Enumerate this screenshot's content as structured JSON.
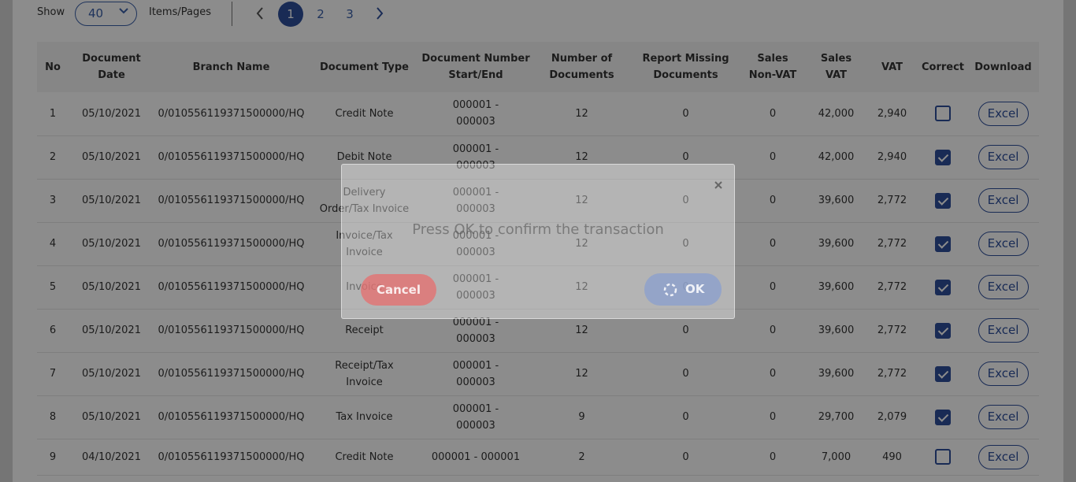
{
  "toolbar": {
    "show_label": "Show",
    "page_size": "40",
    "items_label": "Items/Pages",
    "pages": [
      "1",
      "2",
      "3"
    ],
    "active_page": "1"
  },
  "table": {
    "headers": [
      [
        "No"
      ],
      [
        "Document",
        "Date"
      ],
      [
        "Branch Name"
      ],
      [
        "Document Type"
      ],
      [
        "Document Number",
        "Start/End"
      ],
      [
        "Number of",
        "Documents"
      ],
      [
        "Report Missing",
        "Documents"
      ],
      [
        "Sales",
        "Non-VAT"
      ],
      [
        "Sales",
        "VAT"
      ],
      [
        "VAT"
      ],
      [
        "Correct"
      ],
      [
        "Download"
      ]
    ],
    "rows": [
      {
        "no": "1",
        "date": "05/10/2021",
        "branch": "0/010556119371500000/HQ",
        "type": [
          "Credit Note"
        ],
        "docnum": [
          "000001 -",
          "000003"
        ],
        "count": "12",
        "missing": "0",
        "nonvat": "0",
        "vat_sales": "42,000",
        "vat": "2,940",
        "correct": false,
        "download": "Excel"
      },
      {
        "no": "2",
        "date": "05/10/2021",
        "branch": "0/010556119371500000/HQ",
        "type": [
          "Debit Note"
        ],
        "docnum": [
          "000001 -",
          "000003"
        ],
        "count": "12",
        "missing": "0",
        "nonvat": "0",
        "vat_sales": "42,000",
        "vat": "2,940",
        "correct": true,
        "download": "Excel"
      },
      {
        "no": "3",
        "date": "05/10/2021",
        "branch": "0/010556119371500000/HQ",
        "type": [
          "Delivery",
          "Order/Tax Invoice"
        ],
        "docnum": [
          "000001 -",
          "000003"
        ],
        "count": "12",
        "missing": "0",
        "nonvat": "0",
        "vat_sales": "39,600",
        "vat": "2,772",
        "correct": true,
        "download": "Excel"
      },
      {
        "no": "4",
        "date": "05/10/2021",
        "branch": "0/010556119371500000/HQ",
        "type": [
          "Invoice/Tax",
          "Invoice"
        ],
        "docnum": [
          "000001 -",
          "000003"
        ],
        "count": "12",
        "missing": "0",
        "nonvat": "0",
        "vat_sales": "39,600",
        "vat": "2,772",
        "correct": true,
        "download": "Excel"
      },
      {
        "no": "5",
        "date": "05/10/2021",
        "branch": "0/010556119371500000/HQ",
        "type": [
          "Invoice"
        ],
        "docnum": [
          "000001 -",
          "000003"
        ],
        "count": "12",
        "missing": "0",
        "nonvat": "0",
        "vat_sales": "39,600",
        "vat": "2,772",
        "correct": true,
        "download": "Excel"
      },
      {
        "no": "6",
        "date": "05/10/2021",
        "branch": "0/010556119371500000/HQ",
        "type": [
          "Receipt"
        ],
        "docnum": [
          "000001 -",
          "000003"
        ],
        "count": "12",
        "missing": "0",
        "nonvat": "0",
        "vat_sales": "39,600",
        "vat": "2,772",
        "correct": true,
        "download": "Excel"
      },
      {
        "no": "7",
        "date": "05/10/2021",
        "branch": "0/010556119371500000/HQ",
        "type": [
          "Receipt/Tax",
          "Invoice"
        ],
        "docnum": [
          "000001 -",
          "000003"
        ],
        "count": "12",
        "missing": "0",
        "nonvat": "0",
        "vat_sales": "39,600",
        "vat": "2,772",
        "correct": true,
        "download": "Excel"
      },
      {
        "no": "8",
        "date": "05/10/2021",
        "branch": "0/010556119371500000/HQ",
        "type": [
          "Tax Invoice"
        ],
        "docnum": [
          "000001 -",
          "000003"
        ],
        "count": "9",
        "missing": "0",
        "nonvat": "0",
        "vat_sales": "29,700",
        "vat": "2,079",
        "correct": true,
        "download": "Excel"
      },
      {
        "no": "9",
        "date": "04/10/2021",
        "branch": "0/010556119371500000/HQ",
        "type": [
          "Credit Note"
        ],
        "docnum": [
          "000001 - 000001"
        ],
        "count": "2",
        "missing": "0",
        "nonvat": "0",
        "vat_sales": "7,000",
        "vat": "490",
        "correct": false,
        "download": "Excel"
      }
    ]
  },
  "modal": {
    "message": "Press OK to confirm the transaction",
    "cancel_label": "Cancel",
    "ok_label": "OK"
  },
  "colors": {
    "accent": "#2e4f9b",
    "cancel": "#e76e6e",
    "ok": "#8ca0cd"
  }
}
